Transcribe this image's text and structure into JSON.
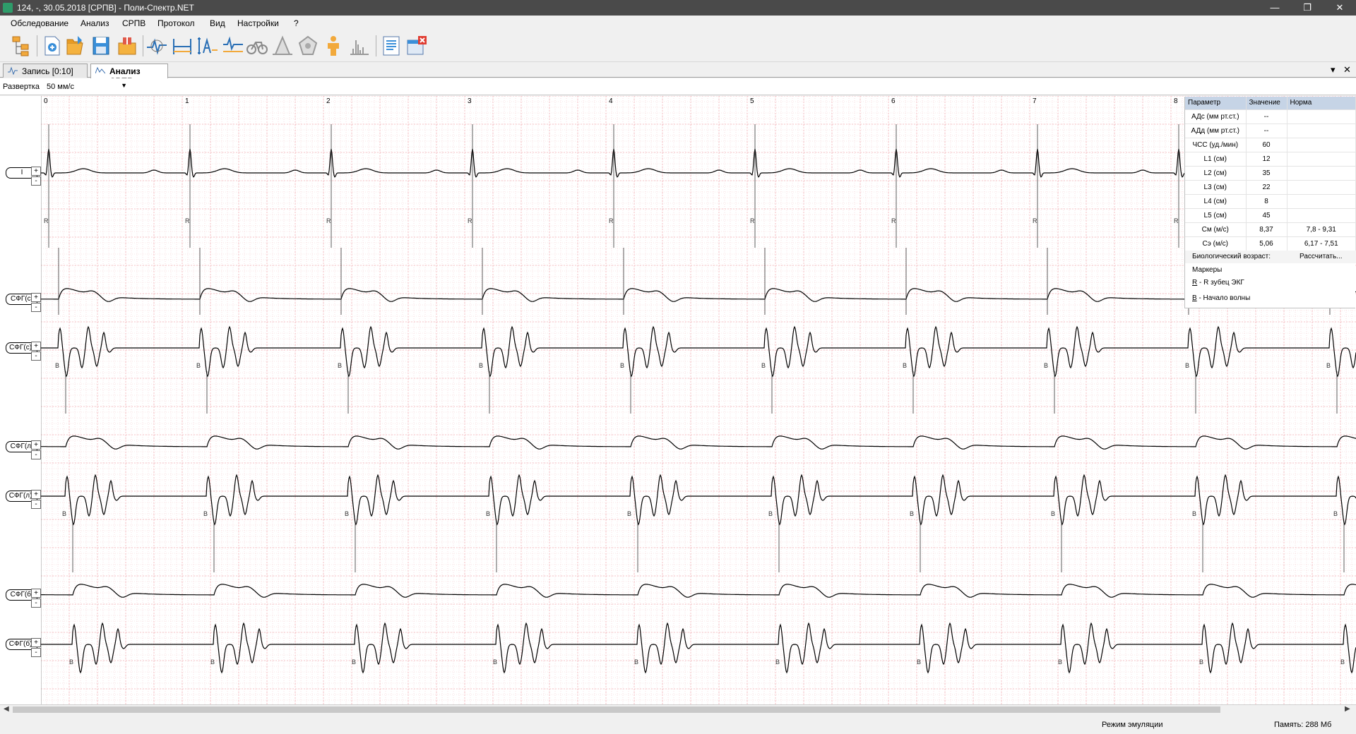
{
  "window": {
    "title": "124, -, 30.05.2018 [СРПВ] - Поли-Спектр.NET",
    "controls": [
      "—",
      "❐",
      "✕"
    ]
  },
  "menu": [
    "Обследование",
    "Анализ",
    "СРПВ",
    "Протокол",
    "Вид",
    "Настройки",
    "?"
  ],
  "toolbar": {
    "buttons": [
      {
        "icon": "structure-tree-icon"
      },
      {
        "icon": "new-exam-icon"
      },
      {
        "icon": "open-exam-icon"
      },
      {
        "icon": "save-exam-icon"
      },
      {
        "icon": "export-icon"
      },
      {
        "icon": "pulse-analysis-icon"
      },
      {
        "icon": "measure-interval-icon"
      },
      {
        "icon": "amplitude-icon"
      },
      {
        "icon": "wave-compare-icon"
      },
      {
        "icon": "bicycle-icon"
      },
      {
        "icon": "peak-icon"
      },
      {
        "icon": "pentagon-icon"
      },
      {
        "icon": "human-body-icon"
      },
      {
        "icon": "spectrum-icon"
      },
      {
        "icon": "report-icon"
      },
      {
        "icon": "close-window-icon"
      }
    ]
  },
  "tabs": [
    {
      "label": "Запись [0:10]",
      "active": false
    },
    {
      "label": "Анализ СРПВ",
      "active": true
    }
  ],
  "tab_controls": [
    "▾",
    "✕"
  ],
  "sweep": {
    "label": "Развертка",
    "value": "50 мм/с"
  },
  "time_ticks": [
    "0",
    "1",
    "2",
    "3",
    "4",
    "5",
    "6",
    "7",
    "8"
  ],
  "channels": [
    {
      "label": "I",
      "type": "ecg",
      "marker": "R"
    },
    {
      "label": "СФГ(с)",
      "type": "pulse",
      "marker": ""
    },
    {
      "label": "СФГ(с)''",
      "type": "deriv",
      "marker": "B"
    },
    {
      "label": "СФГ(л)",
      "type": "pulse",
      "marker": ""
    },
    {
      "label": "СФГ(л)''",
      "type": "deriv",
      "marker": "B"
    },
    {
      "label": "СФГ(б)",
      "type": "pulse",
      "marker": ""
    },
    {
      "label": "СФГ(б)''",
      "type": "deriv",
      "marker": "B"
    }
  ],
  "zoom_labels": {
    "plus": "+",
    "minus": "-"
  },
  "params": {
    "headers": [
      "Параметр",
      "Значение",
      "Норма"
    ],
    "rows": [
      {
        "name": "АДс (мм рт.ст.)",
        "value": "--",
        "norm": ""
      },
      {
        "name": "АДд (мм рт.ст.)",
        "value": "--",
        "norm": ""
      },
      {
        "name": "ЧСС (уд./мин)",
        "value": "60",
        "norm": ""
      },
      {
        "name": "L1 (см)",
        "value": "12",
        "norm": ""
      },
      {
        "name": "L2 (см)",
        "value": "35",
        "norm": ""
      },
      {
        "name": "L3 (см)",
        "value": "22",
        "norm": ""
      },
      {
        "name": "L4 (см)",
        "value": "8",
        "norm": ""
      },
      {
        "name": "L5 (см)",
        "value": "45",
        "norm": ""
      },
      {
        "name": "См (м/с)",
        "value": "8,37",
        "norm": "7,8 - 9,31"
      },
      {
        "name": "Сэ (м/с)",
        "value": "5,06",
        "norm": "6,17 - 7,51"
      }
    ],
    "bio_age_label": "Биологический возраст:",
    "bio_age_action": "Рассчитать...",
    "markers_title": "Маркеры",
    "markers": [
      {
        "key": "R",
        "text": " - R зубец ЭКГ"
      },
      {
        "key": "B",
        "text": " - Начало волны"
      }
    ]
  },
  "status": {
    "mode": "Режим эмуляции",
    "memory": "Память: 288 Мб"
  },
  "colors": {
    "grid": "#f3b3b8",
    "grid_dot": "#f6c9cd",
    "trace": "#000000",
    "accent": "#c6d4e6"
  }
}
